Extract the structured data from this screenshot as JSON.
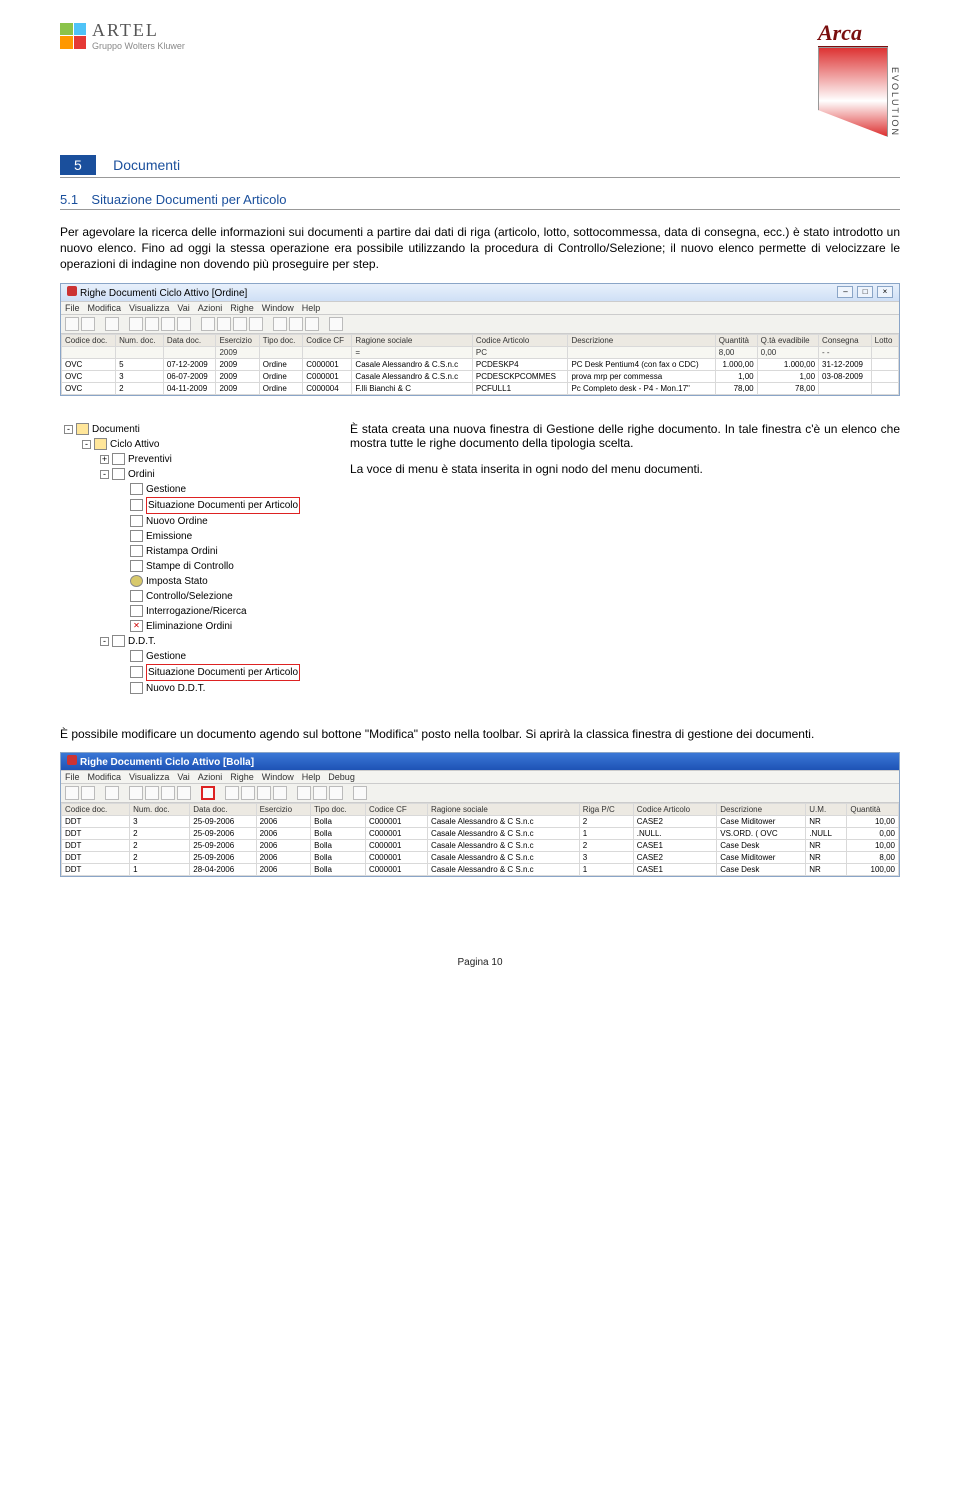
{
  "header": {
    "artel_name": "ARTEL",
    "artel_group": "Gruppo Wolters Kluwer",
    "arca_title": "Arca",
    "arca_evo": "EVOLUTION"
  },
  "section": {
    "num": "5",
    "title": "Documenti"
  },
  "subsection": {
    "num": "5.1",
    "title": "Situazione Documenti per Articolo"
  },
  "para1": "Per agevolare la ricerca delle informazioni sui documenti a partire dai dati di riga (articolo, lotto, sottocommessa, data di consegna, ecc.) è stato introdotto un nuovo elenco. Fino ad oggi la stessa operazione era possibile utilizzando la procedura di Controllo/Selezione; il nuovo elenco permette di velocizzare le operazioni di indagine non dovendo più proseguire per step.",
  "app_top": {
    "title": "Righe Documenti Ciclo Attivo [Ordine]",
    "menus": [
      "File",
      "Modifica",
      "Visualizza",
      "Vai",
      "Azioni",
      "Righe",
      "Window",
      "Help"
    ],
    "cols": [
      "Codice doc.",
      "Num. doc.",
      "Data doc.",
      "Esercizio",
      "Tipo doc.",
      "Codice CF",
      "Ragione sociale",
      "Codice Articolo",
      "Descrizione",
      "Quantità",
      "Q.tà evadibile",
      "Consegna",
      "Lotto"
    ],
    "filter_year": "2009",
    "filter_like": "=",
    "filter_art": "PC",
    "rows": [
      [
        "OVC",
        "5",
        "07-12-2009",
        "2009",
        "Ordine",
        "C000001",
        "Casale Alessandro & C.S.n.c",
        "PCDESKP4",
        "PC Desk Pentium4 (con fax o CDC)",
        "1.000,00",
        "1.000,00",
        "31-12-2009",
        ""
      ],
      [
        "OVC",
        "3",
        "06-07-2009",
        "2009",
        "Ordine",
        "C000001",
        "Casale Alessandro & C.S.n.c",
        "PCDESCKPCOMMES",
        "prova mrp per commessa",
        "1,00",
        "1,00",
        "03-08-2009",
        ""
      ],
      [
        "OVC",
        "2",
        "04-11-2009",
        "2009",
        "Ordine",
        "C000004",
        "F.lli Bianchi & C",
        "PCFULL1",
        "Pc Completo desk - P4 - Mon.17\"",
        "78,00",
        "78,00",
        "",
        ""
      ]
    ],
    "total_qta": "8,00",
    "total_qtev": "0,00",
    "total_cons": "- -"
  },
  "tree": {
    "nodes": [
      {
        "lvl": 1,
        "exp": "-",
        "icon": "folder",
        "label": "Documenti"
      },
      {
        "lvl": 2,
        "exp": "-",
        "icon": "folder",
        "label": "Ciclo Attivo"
      },
      {
        "lvl": 3,
        "exp": "+",
        "icon": "doc",
        "label": "Preventivi"
      },
      {
        "lvl": 3,
        "exp": "-",
        "icon": "doc",
        "label": "Ordini"
      },
      {
        "lvl": 4,
        "exp": " ",
        "icon": "doc",
        "label": "Gestione"
      },
      {
        "lvl": 4,
        "exp": " ",
        "icon": "doc",
        "label": "Situazione Documenti per Articolo",
        "hi": true
      },
      {
        "lvl": 4,
        "exp": " ",
        "icon": "doc",
        "label": "Nuovo Ordine"
      },
      {
        "lvl": 4,
        "exp": " ",
        "icon": "doc",
        "label": "Emissione"
      },
      {
        "lvl": 4,
        "exp": " ",
        "icon": "doc",
        "label": "Ristampa Ordini"
      },
      {
        "lvl": 4,
        "exp": " ",
        "icon": "doc",
        "label": "Stampe di Controllo"
      },
      {
        "lvl": 4,
        "exp": " ",
        "icon": "gear",
        "label": "Imposta Stato"
      },
      {
        "lvl": 4,
        "exp": " ",
        "icon": "doc",
        "label": "Controllo/Selezione"
      },
      {
        "lvl": 4,
        "exp": " ",
        "icon": "doc",
        "label": "Interrogazione/Ricerca"
      },
      {
        "lvl": 4,
        "exp": " ",
        "icon": "del",
        "label": "Eliminazione Ordini"
      },
      {
        "lvl": 3,
        "exp": "-",
        "icon": "doc",
        "label": "D.D.T."
      },
      {
        "lvl": 4,
        "exp": " ",
        "icon": "doc",
        "label": "Gestione"
      },
      {
        "lvl": 4,
        "exp": " ",
        "icon": "doc",
        "label": "Situazione Documenti per Articolo",
        "hi": true
      },
      {
        "lvl": 4,
        "exp": " ",
        "icon": "doc",
        "label": "Nuovo D.D.T."
      }
    ]
  },
  "side_p1": "È stata creata una nuova finestra di Gestione delle righe documento. In tale finestra c'è un elenco che mostra tutte le righe documento della tipologia scelta.",
  "side_p2": "La voce di menu è stata inserita in ogni nodo del menu documenti.",
  "para2": "È possibile modificare un documento agendo sul bottone \"Modifica\" posto nella toolbar. Si aprirà la classica finestra di gestione dei documenti.",
  "app_bottom": {
    "title": "Righe Documenti Ciclo Attivo [Bolla]",
    "menus": [
      "File",
      "Modifica",
      "Visualizza",
      "Vai",
      "Azioni",
      "Righe",
      "Window",
      "Help",
      "Debug"
    ],
    "cols": [
      "Codice doc.",
      "Num. doc.",
      "Data doc.",
      "Esercizio",
      "Tipo doc.",
      "Codice CF",
      "Ragione sociale",
      "Riga P/C",
      "Codice Articolo",
      "Descrizione",
      "U.M.",
      "Quantità"
    ],
    "rows": [
      [
        "DDT",
        "3",
        "25-09-2006",
        "2006",
        "Bolla",
        "C000001",
        "Casale Alessandro & C S.n.c",
        "2",
        "CASE2",
        "Case Miditower",
        "NR",
        "10,00"
      ],
      [
        "DDT",
        "2",
        "25-09-2006",
        "2006",
        "Bolla",
        "C000001",
        "Casale Alessandro & C S.n.c",
        "1",
        ".NULL.",
        "VS.ORD. ( OVC",
        ".NULL",
        "0,00"
      ],
      [
        "DDT",
        "2",
        "25-09-2006",
        "2006",
        "Bolla",
        "C000001",
        "Casale Alessandro & C S.n.c",
        "2",
        "CASE1",
        "Case Desk",
        "NR",
        "10,00"
      ],
      [
        "DDT",
        "2",
        "25-09-2006",
        "2006",
        "Bolla",
        "C000001",
        "Casale Alessandro & C S.n.c",
        "3",
        "CASE2",
        "Case Miditower",
        "NR",
        "8,00"
      ],
      [
        "DDT",
        "1",
        "28-04-2006",
        "2006",
        "Bolla",
        "C000001",
        "Casale Alessandro & C S.n.c",
        "1",
        "CASE1",
        "Case Desk",
        "NR",
        "100,00"
      ]
    ]
  },
  "footer": "Pagina 10"
}
